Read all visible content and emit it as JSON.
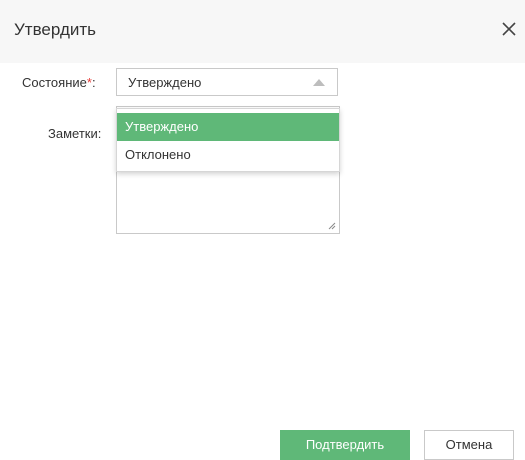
{
  "dialog": {
    "title": "Утвердить",
    "close_icon": "close-icon"
  },
  "form": {
    "status_label": "Состояние",
    "required_mark": "*",
    "label_suffix": ":",
    "status_value": "Утверждено",
    "notes_label": "Заметки:",
    "notes_value": ""
  },
  "dropdown": {
    "options": [
      {
        "label": "Утверждено",
        "selected": true
      },
      {
        "label": "Отклонено",
        "selected": false
      }
    ]
  },
  "buttons": {
    "confirm_label": "Подтвердить",
    "cancel_label": "Отмена"
  },
  "colors": {
    "accent": "#5fb878",
    "required": "#e53935",
    "header_bg": "#f7f7f7"
  }
}
